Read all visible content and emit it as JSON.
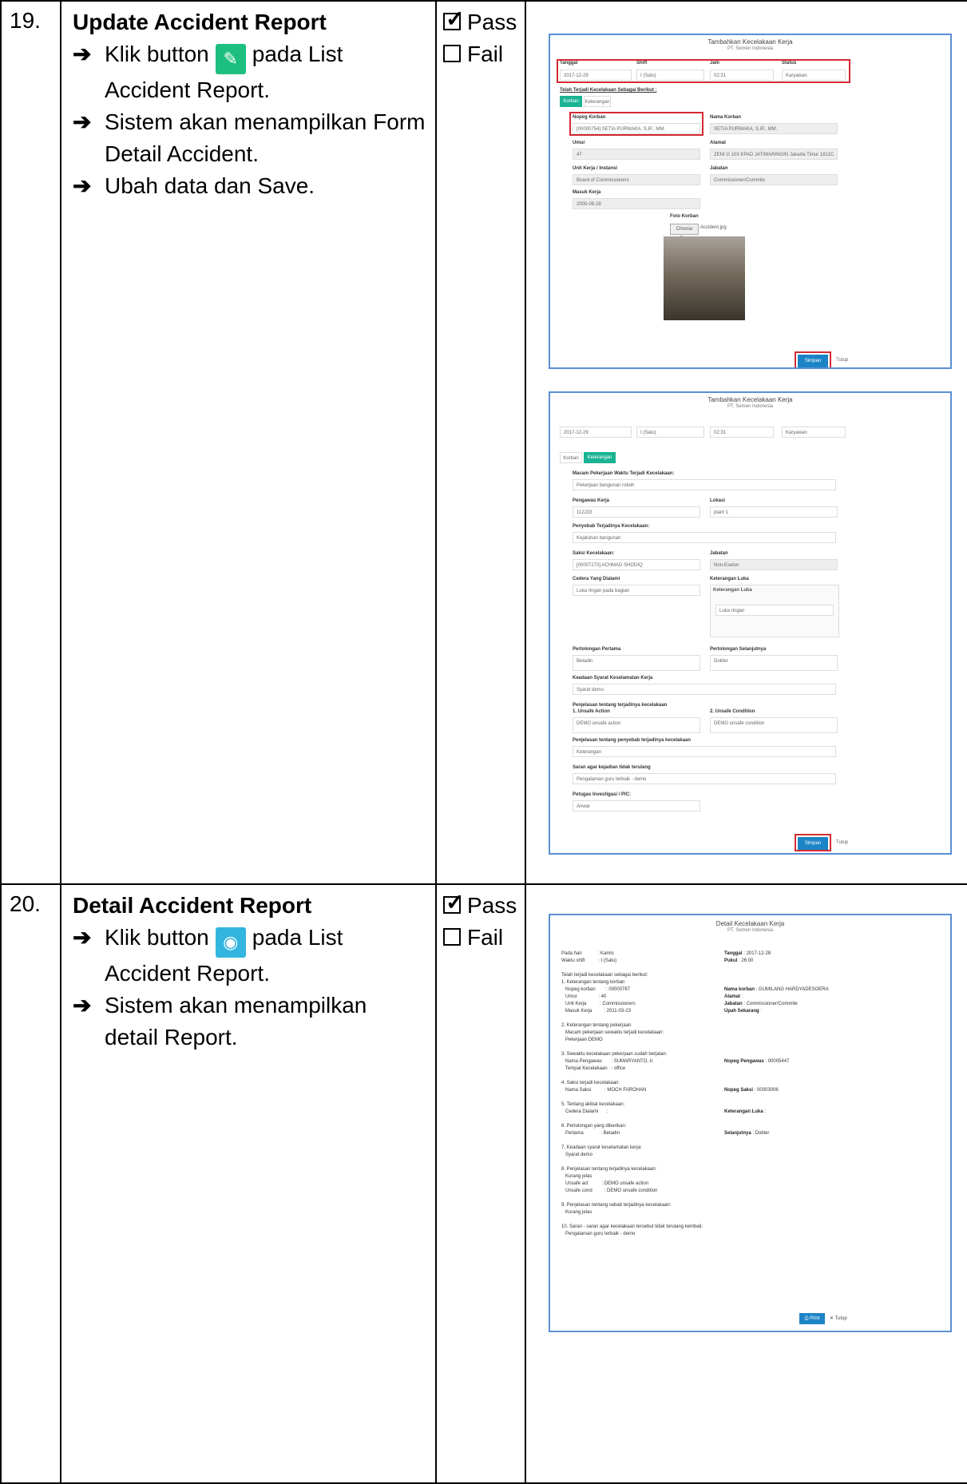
{
  "rows": [
    {
      "no": "19.",
      "title": "Update Accident Report",
      "steps": [
        {
          "prefix": "Klik button",
          "suffix": "pada List Accident Report."
        },
        {
          "text": "Sistem akan menampilkan Form Detail Accident."
        },
        {
          "text": "Ubah data dan Save."
        }
      ],
      "pass": "Pass",
      "fail": "Fail"
    },
    {
      "no": "20.",
      "title": "Detail Accident Report",
      "steps": [
        {
          "prefix": "Klik button",
          "suffix": "pada List Accident Report."
        },
        {
          "text": "Sistem akan menampilkan detail Report."
        }
      ],
      "pass": "Pass",
      "fail": "Fail"
    }
  ],
  "shot1": {
    "title": "Tambahkan Kecelakaan Kerja",
    "subtitle": "PT. Semen Indonesia",
    "tanggal_label": "Tanggal",
    "tanggal": "2017-12-29",
    "shift_label": "Shift",
    "shift": "I (Satu)",
    "jam_label": "Jam",
    "jam": "02:31",
    "status_label": "Status",
    "status": "Karyawan",
    "intro": "Telah Terjadi Kecelakaan Sebagai Berikut :",
    "tab1": "Korban",
    "tab2": "Keterangan",
    "nopeg_label": "Nopeg Korban",
    "nopeg": "[00000754] SETIA PURWAKA, S.IP., MM.",
    "nama_label": "Nama Korban",
    "nama": "SETIA PURWAKA, S.IP., MM.",
    "umur_label": "Umur",
    "umur": "47",
    "alamat_label": "Alamat",
    "alamat": "ZENI G 103 KPAD JATIWARINGIN Jakarta Timur 1811C",
    "unit_label": "Unit Kerja / Instansi",
    "unit": "Board of Commissioners",
    "jabatan_label": "Jabatan",
    "jabatan": "Commissioner/Commite",
    "masuk_label": "Masuk Kerja",
    "masuk": "2005-08-28",
    "foto_label": "Foto Korban",
    "choose": "Choose Files",
    "file": "Accident.jpg",
    "simpan": "Simpan",
    "tutup": "Tutup"
  },
  "shot2": {
    "title": "Tambahkan Kecelakaan Kerja",
    "subtitle": "PT. Semen Indonesia",
    "tanggal": "2017-12-29",
    "shift": "I (Satu)",
    "jam": "02:31",
    "status": "Karyawan",
    "f1_label": "Macam Pekerjaan Waktu Terjadi Kecelakaan:",
    "f1": "Pekerjaan bangunan roboh",
    "f2_label": "Pengawas Kerja",
    "f2": "112233",
    "f3_label": "Lokasi",
    "f3": "plant 1",
    "f4_label": "Penyebab Terjadinya Kecelakaan:",
    "f4": "Kejatuhan bangunan",
    "f5_label": "Saksi Kecelakaan:",
    "f5": "[00007273] ACHMAD SHODIQ",
    "f6_label": "Jabatan",
    "f6": "Non-Eselon",
    "f7_label": "Cedera Yang Dialami",
    "f7": "Luka ringan pada bagian",
    "f8_label": "Keterangan Luka",
    "f8a": "Keterangan Luka",
    "f8b": "Luka ringan",
    "f9_label": "Pertolongan Pertama",
    "f9": "Betadin",
    "f10_label": "Pertolongan Selanjutnya",
    "f10": "Dokter",
    "f11_label": "Keadaan Syarat Keselamatan Kerja",
    "f11": "Syarat demo",
    "f12_label": "Penjelasan tentang terjadinya kecelakaan",
    "f12a_label": "1. Unsafe Action",
    "f12a": "DEMO unsafe action",
    "f12b_label": "2. Unsafe Condition",
    "f12b": "DEMO unsafe condition",
    "f13_label": "Penjelasan tentang penyebab terjadinya kecelakaan",
    "f13": "Keterangan",
    "f14_label": "Saran agar kejadian tidak terulang",
    "f14": "Pengalaman guru terbaik - demo",
    "f15_label": "Petugas Investigasi / PIC:",
    "f15": "Anwar",
    "simpan": "Simpan",
    "tutup": "Tutup"
  },
  "shot3": {
    "title": "Detail Kecelakaan Kerja",
    "subtitle": "PT. Semen Indonesia",
    "lines_left": [
      "Pada hari            : Kamis",
      "Waktu shift          : I (Satu)",
      "",
      "Telah terjadi kecelakaan sebagai berikut:",
      "1. Keterangan tentang korban",
      "   Nopeg korban        : 00000787",
      "   Umur                : 40",
      "   Unit Kerja          : Commissioners",
      "   Masuk Kerja         : 2011-03-23",
      "",
      "2. Keterangan tentang pekerjaan",
      "   Macam pekerjaan sewaktu terjadi kecelakaan:",
      "   Pekerjaan DEMO",
      "",
      "3. Sewaktu kecelakaan pekerjaan sudah berjalan:",
      "   Nama Pengawas       : SUMARYANTO, Ir.",
      "   Tempat Kecelakaan   : office",
      "",
      "4. Saksi terjadi kecelakaan:",
      "   Nama Saksi          : MOCH FAROHAN",
      "",
      "5. Tentang akibat kecelakaan:",
      "   Cedera Dialami      :",
      "",
      "6. Pertolongan yang diberikan:",
      "   Pertama             : Betadin",
      "",
      "7. Keadaan syarat keselamatan kerja:",
      "   Syarat demo",
      "",
      "8. Penjelasan tentang terjadinya kecelakaan:",
      "   Kurang jelas",
      "   Unsafe act          : DEMO unsafe action",
      "   Unsafe cond         : DEMO unsafe condition",
      "",
      "9. Penjelasan tentang sebab terjadinya kecelakaan:",
      "   Kurang jelas",
      "",
      "10. Saran - saran agar kecelakaan tersebut tidak terulang kembali:",
      "   Pengalaman guru terbaik - demo"
    ],
    "lines_right": [
      {
        "label": "Tanggal",
        "value": ": 2017-12-28"
      },
      {
        "label": "Pukul",
        "value": ": 26:00"
      },
      {
        "label": "Nama korban",
        "value": ": GUMILANG HARDYADESOERA"
      },
      {
        "label": "Alamat",
        "value": ":"
      },
      {
        "label": "Jabatan",
        "value": ": Commissioner/Commite"
      },
      {
        "label": "Upah Sekarang",
        "value": ":"
      },
      {
        "label": "Nopeg Pengawas",
        "value": ": 00005447"
      },
      {
        "label": "Nopeg Saksi",
        "value": ": 00003006"
      },
      {
        "label": "Keterangan Luka",
        "value": ":"
      },
      {
        "label": "Selanjutnya",
        "value": ": Dokter"
      }
    ],
    "print": "Print",
    "tutup": "Tutup"
  }
}
